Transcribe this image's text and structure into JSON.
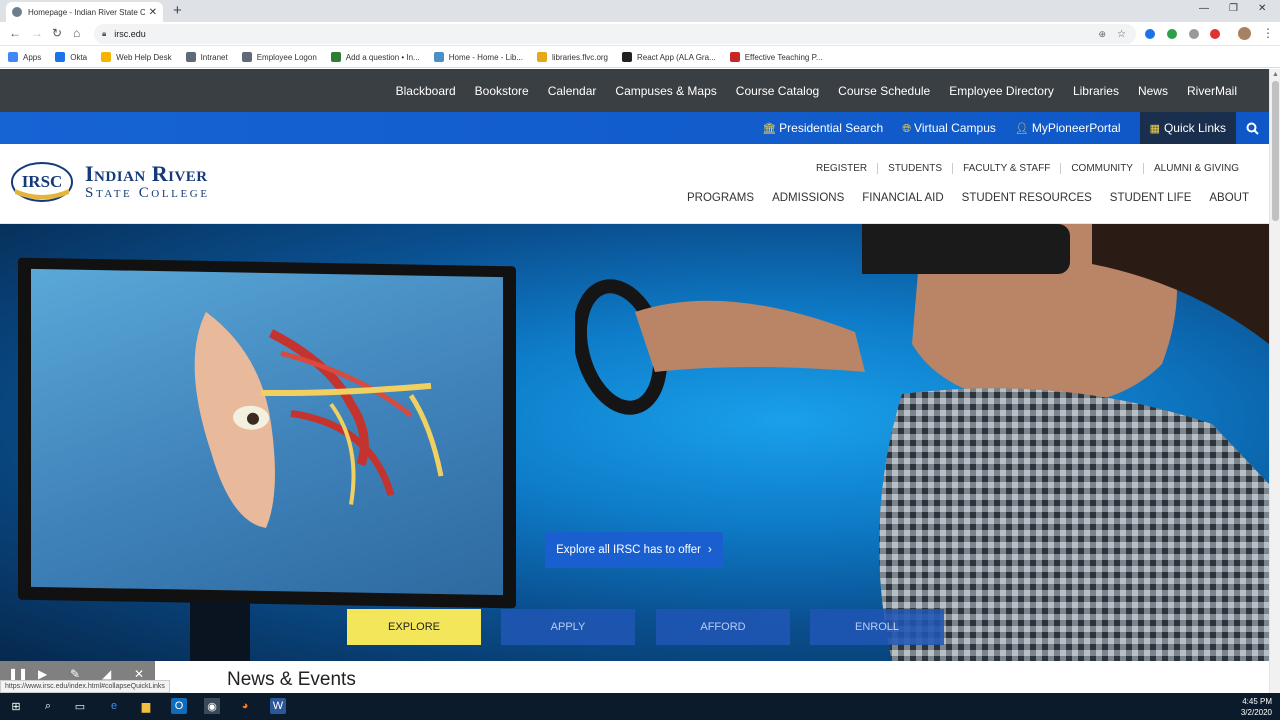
{
  "browser": {
    "tab_title": "Homepage - Indian River State C",
    "url": "irsc.edu",
    "bookmarks": [
      {
        "label": "Apps",
        "color": "#4285f4"
      },
      {
        "label": "Okta",
        "color": "#1a73e8"
      },
      {
        "label": "Web Help Desk",
        "color": "#f4b400"
      },
      {
        "label": "Intranet",
        "color": "#5f6b7a"
      },
      {
        "label": "Employee Logon",
        "color": "#5f6b7a"
      },
      {
        "label": "Add a question • In...",
        "color": "#2e7d32"
      },
      {
        "label": "Home - Home - Lib...",
        "color": "#4a90c8"
      },
      {
        "label": "libraries.flvc.org",
        "color": "#e6a817"
      },
      {
        "label": "React App (ALA Gra...",
        "color": "#222"
      },
      {
        "label": "Effective Teaching P...",
        "color": "#c62828"
      }
    ],
    "status_url": "https://www.irsc.edu/index.html#collapseQuickLinks"
  },
  "site": {
    "topnav": [
      "Blackboard",
      "Bookstore",
      "Calendar",
      "Campuses & Maps",
      "Course Catalog",
      "Course Schedule",
      "Employee Directory",
      "Libraries",
      "News",
      "RiverMail"
    ],
    "bluebar": {
      "presidential": "Presidential Search",
      "virtual": "Virtual Campus",
      "portal": "MyPioneerPortal",
      "quick_links": "Quick Links"
    },
    "logo": {
      "mark": "IRSC",
      "line1": "Indian River",
      "line2": "State College"
    },
    "util_nav": [
      "REGISTER",
      "STUDENTS",
      "FACULTY & STAFF",
      "COMMUNITY",
      "ALUMNI & GIVING"
    ],
    "main_nav": [
      "PROGRAMS",
      "ADMISSIONS",
      "FINANCIAL AID",
      "STUDENT RESOURCES",
      "STUDENT LIFE",
      "ABOUT"
    ],
    "hero": {
      "cta": "Explore all IRSC has to offer",
      "tabs": [
        "EXPLORE",
        "APPLY",
        "AFFORD",
        "ENROLL"
      ],
      "active_tab": "EXPLORE"
    },
    "news_heading": "News & Events"
  },
  "taskbar": {
    "time": "4:45 PM",
    "date": "3/2/2020"
  },
  "colors": {
    "topnav_bg": "#3a3f44",
    "bluebar": "#1663d4",
    "brand_navy": "#153a7a",
    "accent_yellow": "#f4e65a"
  }
}
